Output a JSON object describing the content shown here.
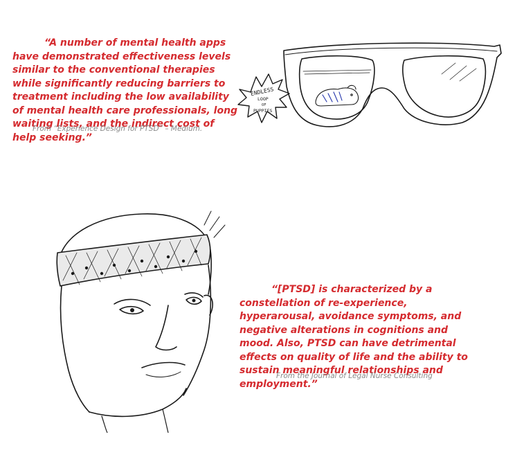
{
  "top_quote": {
    "text": "“A number of mental health apps have demonstrated effectiveness levels similar to the conventional therapies while significantly reducing barriers to treatment including the low availability of mental health care professionals, long waiting lists, and the indirect cost of help seeking.”",
    "source": "From “Experience Design for PTSD” – Medium."
  },
  "glasses_sketch": {
    "starburst_lines": [
      "ENDLESS",
      "LOOP",
      "OF",
      "PUPPIES"
    ]
  },
  "bottom_quote": {
    "text": "“[PTSD] is characterized by a constellation of re-experience, hyperarousal, avoidance symptoms, and negative alterations in cognitions and mood. Also, PTSD can have detrimental effects on quality of life and the ability to sustain meaningful relationships and employment.”",
    "source": "From the Journal of Legal Nurse Consulting"
  },
  "colors": {
    "quote_text": "#d52b2f",
    "source_text": "#8a8a8a",
    "ink": "#1a1a1a"
  }
}
